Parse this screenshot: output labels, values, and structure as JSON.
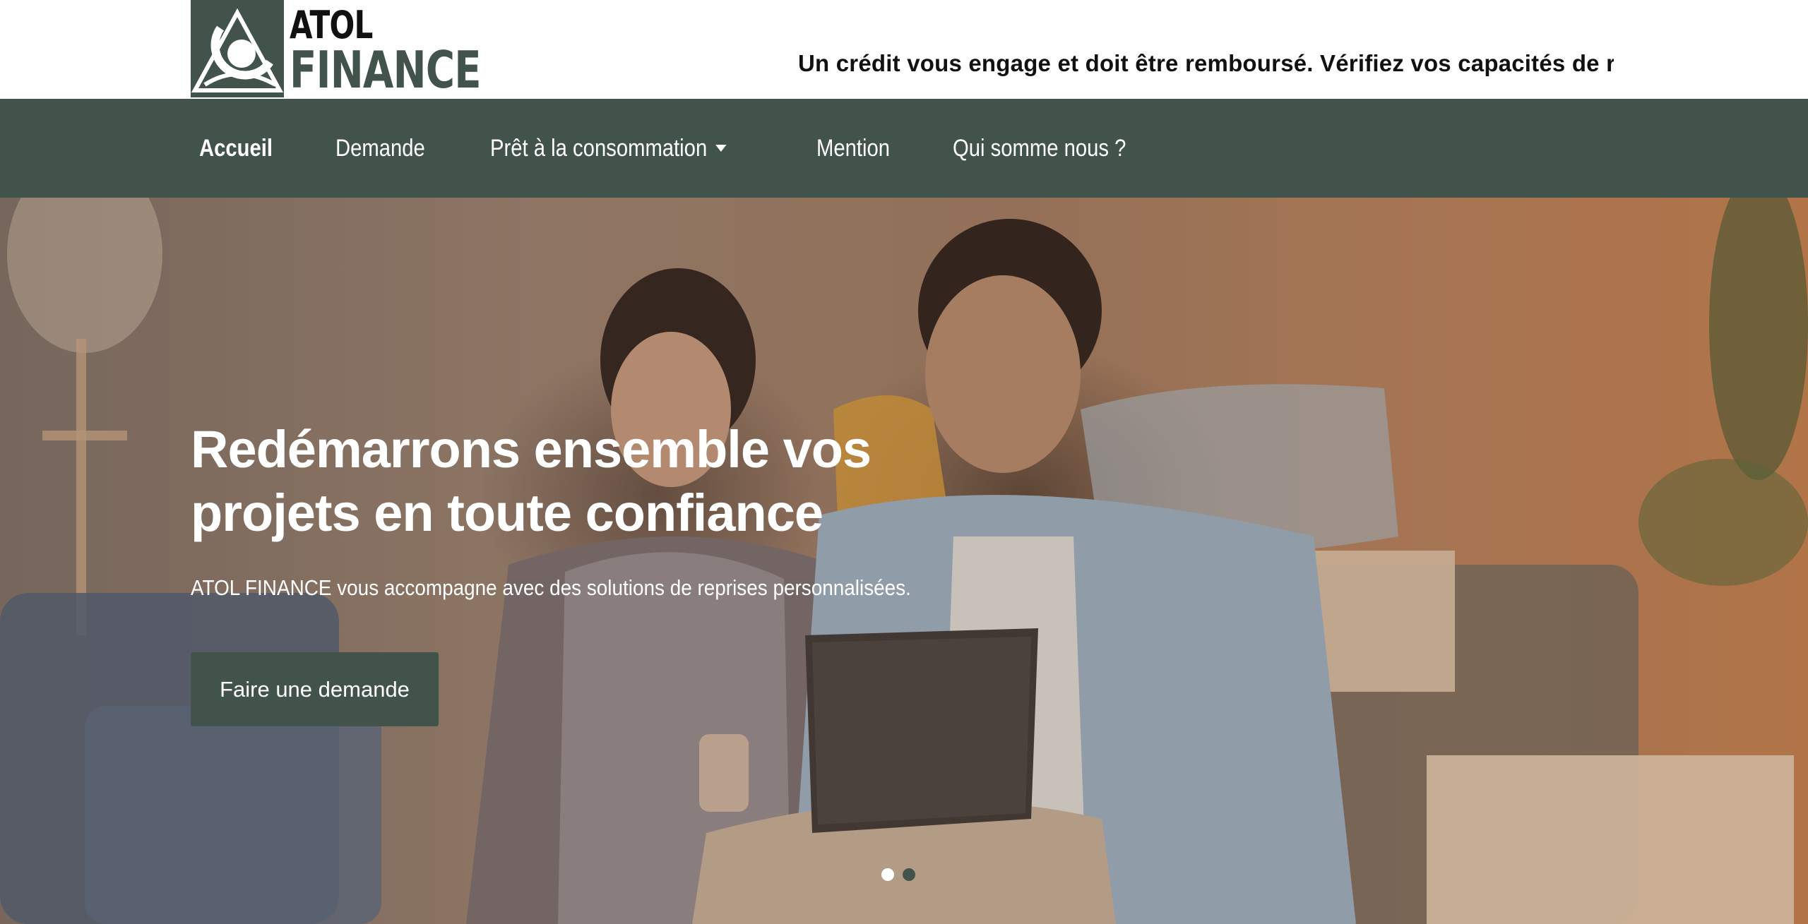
{
  "header": {
    "logo": {
      "line1": "ATOL",
      "line2": "FINANCE"
    },
    "ticker": "Un crédit vous engage et doit être remboursé. Vérifiez vos capacités de rer"
  },
  "nav": {
    "items": [
      {
        "label": "Accueil",
        "active": true
      },
      {
        "label": "Demande"
      },
      {
        "label": "Prêt à la consommation",
        "dropdown": true
      },
      {
        "label": "Mention"
      },
      {
        "label": "Qui somme nous ?"
      }
    ]
  },
  "hero": {
    "title": "Redémarrons ensemble vos projets en toute confiance",
    "subtitle": "ATOL FINANCE vous accompagne avec des solutions de reprises personnalisées.",
    "cta_label": "Faire une demande",
    "carousel": {
      "slides": 2,
      "active_index": 0
    }
  },
  "colors": {
    "brand": "#42534c",
    "text_light": "#ffffff",
    "text_dark": "#111111"
  },
  "icons": [
    "logo-emblem-icon",
    "caret-down-icon"
  ]
}
